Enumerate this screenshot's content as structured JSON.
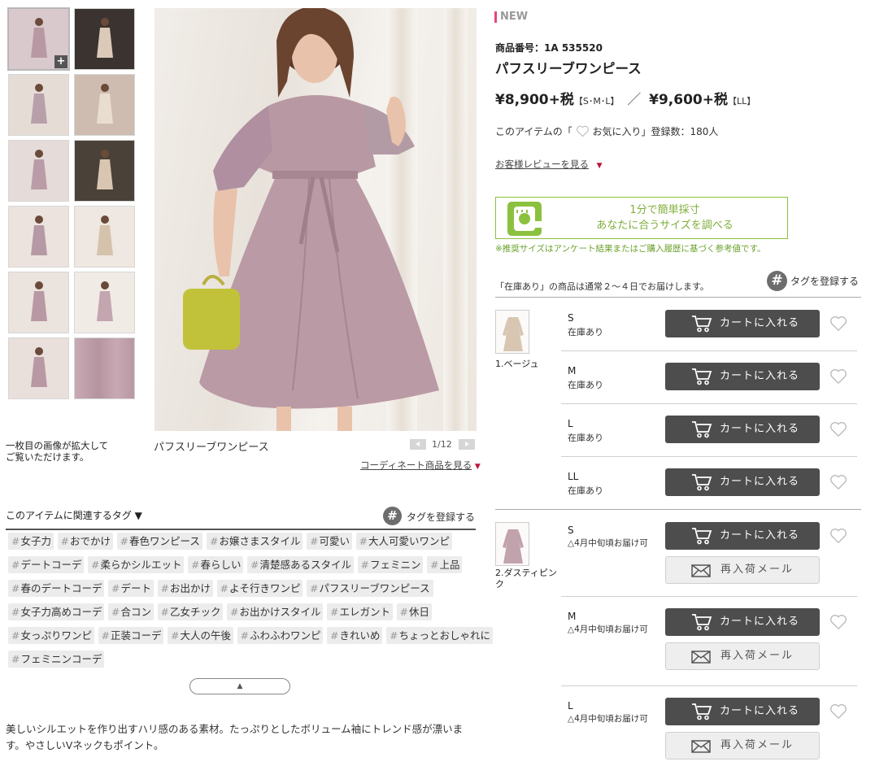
{
  "gallery": {
    "thumbs": [
      "thumb-1",
      "thumb-2",
      "thumb-3",
      "thumb-4",
      "thumb-5",
      "thumb-6",
      "thumb-7",
      "thumb-8",
      "thumb-9",
      "thumb-10",
      "thumb-11",
      "thumb-12"
    ],
    "zoom_note": "一枚目の画像が拡大して\nご覧いただけます。",
    "caption": "パフスリーブワンピース",
    "counter": "1/12",
    "coordinate_link": "コーディネート商品を見る"
  },
  "tags_section": {
    "title": "このアイテムに関連するタグ ▼",
    "register_label": "タグを登録する",
    "tags": [
      "女子力",
      "おでかけ",
      "春色ワンピース",
      "お嬢さまスタイル",
      "可愛い",
      "大人可愛いワンピ",
      "デートコーデ",
      "柔らかシルエット",
      "春らしい",
      "清楚感あるスタイル",
      "フェミニン",
      "上品",
      "春のデートコーデ",
      "デート",
      "お出かけ",
      "よそ行きワンピ",
      "パフスリーブワンピース",
      "女子力高めコーデ",
      "合コン",
      "乙女チック",
      "お出かけスタイル",
      "エレガント",
      "休日",
      "女っぷりワンピ",
      "正装コーデ",
      "大人の午後",
      "ふわふわワンピ",
      "きれいめ",
      "ちょっとおしゃれに",
      "フェミニンコーデ"
    ],
    "collapse_symbol": "▲"
  },
  "description": "美しいシルエットを作り出すハリ感のある素材。たっぷりとしたボリューム袖にトレンド感が漂います。やさしいVネックもポイント。",
  "product": {
    "badge": "NEW",
    "number_label": "商品番号：1A 535520",
    "name": "パフスリーブワンピース",
    "price1": "¥8,900+税",
    "price1_sizes": "【S･M･L】",
    "price_sep": "／",
    "price2": "¥9,600+税",
    "price2_sizes": "【LL】",
    "fav_prefix": "このアイテムの「",
    "fav_label": "お気に入り」登録数：180人",
    "review_link": "お客様レビューを見る",
    "fit_line1": "1分で簡単採寸",
    "fit_line2": "あなたに合うサイズを調べる",
    "fit_note": "※推奨サイズはアンケート結果またはご購入履歴に基づく参考値です。",
    "delivery_note": "「在庫あり」の商品は通常２～４日でお届けします。",
    "tag_register": "タグを登録する"
  },
  "variants": [
    {
      "color": "1.ベージュ",
      "sizes": [
        {
          "size": "S",
          "stock": "在庫あり",
          "cart": "カートに入れる"
        },
        {
          "size": "M",
          "stock": "在庫あり",
          "cart": "カートに入れる"
        },
        {
          "size": "L",
          "stock": "在庫あり",
          "cart": "カートに入れる"
        },
        {
          "size": "LL",
          "stock": "在庫あり",
          "cart": "カートに入れる"
        }
      ]
    },
    {
      "color": "2.ダスティピンク",
      "sizes": [
        {
          "size": "S",
          "stock": "△4月中旬頃お届け可",
          "cart": "カートに入れる",
          "mail": "再入荷メール"
        },
        {
          "size": "M",
          "stock": "△4月中旬頃お届け可",
          "cart": "カートに入れる",
          "mail": "再入荷メール"
        },
        {
          "size": "L",
          "stock": "△4月中旬頃お届け可",
          "cart": "カートに入れる",
          "mail": "再入荷メール"
        }
      ]
    }
  ],
  "colors": {
    "accent_pink": "#e5467b",
    "fit_green": "#8cc13f",
    "cart_bg": "#4d4d4d",
    "dress": "#b99aa3"
  }
}
